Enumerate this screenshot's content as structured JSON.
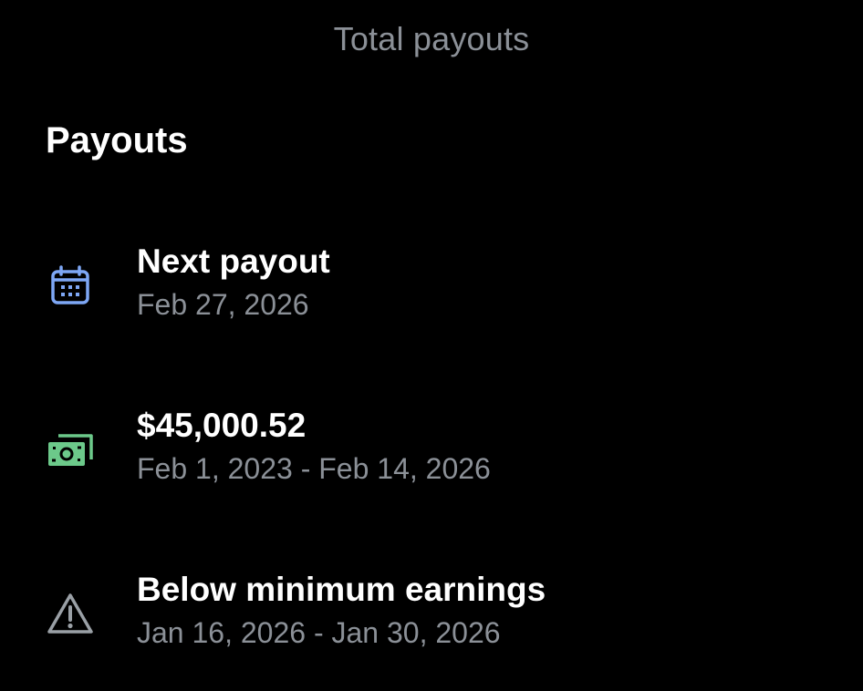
{
  "header": {
    "title": "Total payouts"
  },
  "section": {
    "heading": "Payouts"
  },
  "rows": [
    {
      "icon": "calendar-icon",
      "title": "Next payout",
      "subtitle": "Feb 27, 2026",
      "icon_color": "#7ea7f5"
    },
    {
      "icon": "money-icon",
      "title": "$45,000.52",
      "subtitle": "Feb 1, 2023 - Feb 14, 2026",
      "icon_color": "#6cc98a"
    },
    {
      "icon": "warning-icon",
      "title": "Below minimum earnings",
      "subtitle": "Jan 16, 2026 - Jan 30, 2026",
      "icon_color": "#9aa0a6"
    }
  ],
  "colors": {
    "background": "#000000",
    "primary_text": "#ffffff",
    "secondary_text": "#8b9097"
  }
}
